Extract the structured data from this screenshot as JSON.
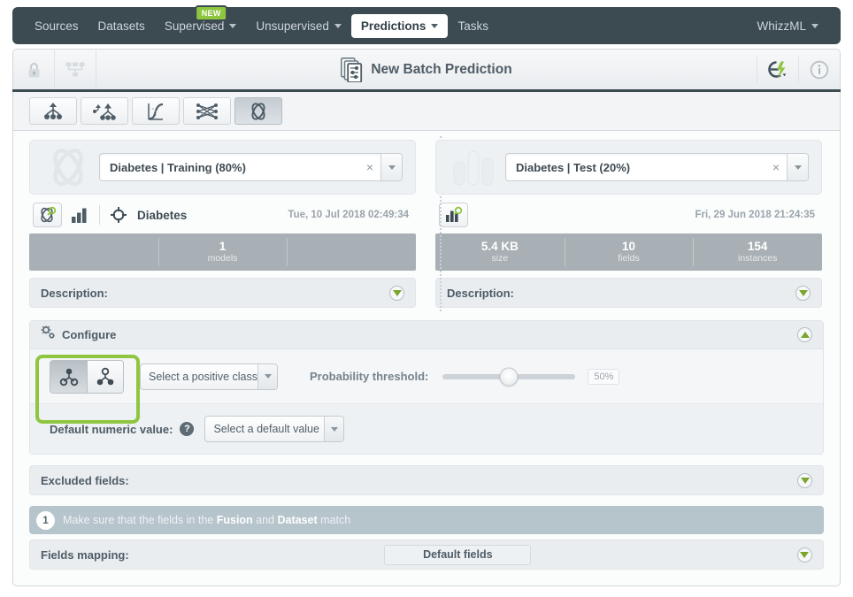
{
  "topnav": {
    "items": [
      {
        "label": "Sources",
        "caret": false,
        "active": false,
        "badge": null
      },
      {
        "label": "Datasets",
        "caret": false,
        "active": false,
        "badge": null
      },
      {
        "label": "Supervised",
        "caret": true,
        "active": false,
        "badge": "NEW"
      },
      {
        "label": "Unsupervised",
        "caret": true,
        "active": false,
        "badge": null
      },
      {
        "label": "Predictions",
        "caret": true,
        "active": true,
        "badge": null
      },
      {
        "label": "Tasks",
        "caret": false,
        "active": false,
        "badge": null
      }
    ],
    "account": {
      "label": "WhizzML",
      "caret": true
    },
    "bg_color": "#3c4a52",
    "badge_color": "#8ec63f"
  },
  "titlebar": {
    "title": "New Batch Prediction",
    "lock_icon": "lock-icon",
    "sitemap_icon": "sitemap-icon",
    "title_icon": "batch-prediction-icon",
    "flash_icon": "flash-actions-icon",
    "info_icon": "info-icon"
  },
  "typebar": {
    "buttons": [
      {
        "icon": "decision-tree-icon",
        "name": "model",
        "selected": false
      },
      {
        "icon": "ensemble-icon",
        "name": "ensemble",
        "selected": false
      },
      {
        "icon": "logistic-regression-icon",
        "name": "logistic-regression",
        "selected": false
      },
      {
        "icon": "deepnet-icon",
        "name": "deepnet",
        "selected": false
      },
      {
        "icon": "fusion-icon",
        "name": "fusion",
        "selected": true
      }
    ]
  },
  "left_panel": {
    "watermark_icon": "fusion-watermark-icon",
    "selector": {
      "value": "Diabetes | Training (80%)",
      "clear": "×"
    },
    "resource_icon": "fusion-search-icon",
    "chart_icon": "bar-chart-icon",
    "objective_icon": "objective-target-icon",
    "name": "Diabetes",
    "date": "Tue, 10 Jul 2018 02:49:34",
    "stats": [
      {
        "value": "",
        "label": ""
      },
      {
        "value": "1",
        "label": "models"
      },
      {
        "value": "",
        "label": ""
      }
    ],
    "description_label": "Description:"
  },
  "right_panel": {
    "watermark_icon": "dataset-watermark-icon",
    "selector": {
      "value": "Diabetes | Test (20%)",
      "clear": "×"
    },
    "resource_icon": "dataset-search-icon",
    "date": "Fri, 29 Jun 2018 21:24:35",
    "stats": [
      {
        "value": "5.4 KB",
        "label": "size"
      },
      {
        "value": "10",
        "label": "fields"
      },
      {
        "value": "154",
        "label": "instances"
      }
    ],
    "description_label": "Description:"
  },
  "configure": {
    "icon": "gears-icon",
    "title": "Configure",
    "collapse_icon": "chevron-up-icon",
    "class_toggle": [
      {
        "icon": "single-class-icon",
        "name": "all-classes",
        "selected": true
      },
      {
        "icon": "all-classes-icon",
        "name": "positive-class",
        "selected": false
      }
    ],
    "positive_class": {
      "value": "Select a positive class"
    },
    "threshold_label": "Probability threshold:",
    "threshold_value": "50%",
    "threshold_percent": 50,
    "default_numeric_label": "Default numeric value:",
    "help_glyph": "?",
    "default_numeric_value": "Select a default value",
    "highlight_color": "#8ec63f"
  },
  "excluded_fields": {
    "label": "Excluded fields:",
    "expand_icon": "chevron-down-icon"
  },
  "message": {
    "number": "1",
    "prefix": "Make sure that the fields in the ",
    "bold1": "Fusion",
    "middle": " and ",
    "bold2": "Dataset",
    "suffix": " match"
  },
  "fields_mapping": {
    "label": "Fields mapping:",
    "button": "Default fields",
    "expand_icon": "chevron-down-icon"
  }
}
